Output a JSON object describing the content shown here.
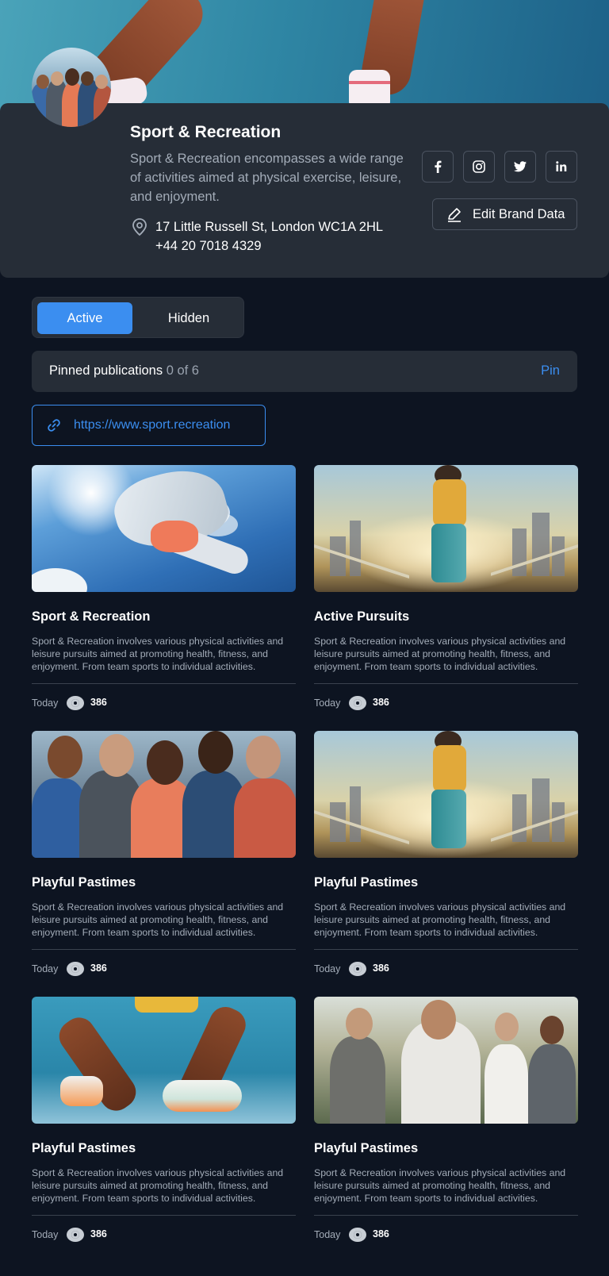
{
  "brand": {
    "name": "Sport & Recreation",
    "description": "Sport & Recreation encompasses a wide range of activities aimed at physical exercise, leisure, and enjoyment.",
    "address": "17 Little Russell St, London WC1A 2HL",
    "phone": "+44 20 7018 4329",
    "edit_button": "Edit Brand Data",
    "socials": [
      "facebook-icon",
      "instagram-icon",
      "twitter-icon",
      "linkedin-icon"
    ]
  },
  "tabs": {
    "active": "Active",
    "hidden": "Hidden"
  },
  "pinned": {
    "label": "Pinned publications",
    "count": "0 of 6",
    "action": "Pin"
  },
  "website": {
    "url": "https://www.sport.recreation"
  },
  "colors": {
    "accent": "#3b8ef0",
    "background": "#0d1421",
    "card": "#262d37"
  },
  "publications": [
    {
      "title": "Sport & Recreation",
      "description": "Sport & Recreation involves various physical activities and leisure pursuits aimed at promoting health, fitness, and enjoyment. From team sports to individual activities.",
      "date": "Today",
      "views": "386"
    },
    {
      "title": "Active Pursuits",
      "description": "Sport & Recreation involves various physical activities and leisure pursuits aimed at promoting health, fitness, and enjoyment. From team sports to individual activities.",
      "date": "Today",
      "views": "386"
    },
    {
      "title": "Playful Pastimes",
      "description": "Sport & Recreation involves various physical activities and leisure pursuits aimed at promoting health, fitness, and enjoyment. From team sports to individual activities.",
      "date": "Today",
      "views": "386"
    },
    {
      "title": "Playful Pastimes",
      "description": "Sport & Recreation involves various physical activities and leisure pursuits aimed at promoting health, fitness, and enjoyment. From team sports to individual activities.",
      "date": "Today",
      "views": "386"
    },
    {
      "title": "Playful Pastimes",
      "description": "Sport & Recreation involves various physical activities and leisure pursuits aimed at promoting health, fitness, and enjoyment. From team sports to individual activities.",
      "date": "Today",
      "views": "386"
    },
    {
      "title": "Playful Pastimes",
      "description": "Sport & Recreation involves various physical activities and leisure pursuits aimed at promoting health, fitness, and enjoyment. From team sports to individual activities.",
      "date": "Today",
      "views": "386"
    }
  ]
}
